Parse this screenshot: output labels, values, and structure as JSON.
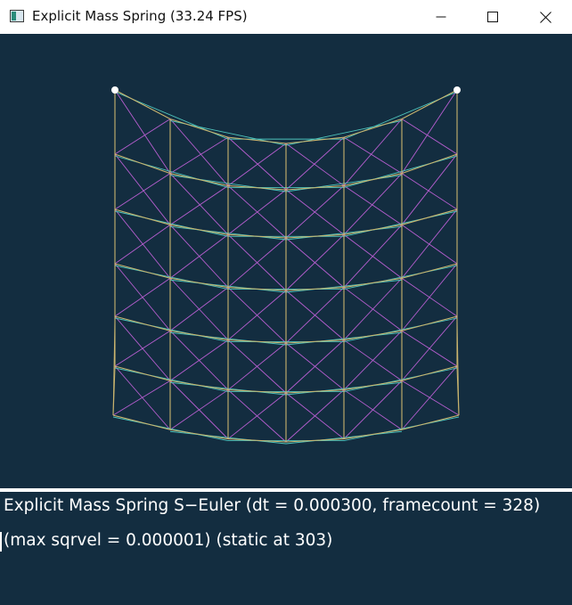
{
  "window": {
    "title": "Explicit Mass Spring (33.24 FPS)",
    "controls": {
      "minimize": "minimize-icon",
      "maximize": "maximize-icon",
      "close": "close-icon"
    }
  },
  "status": {
    "line1": "Explicit Mass Spring S−Euler (dt = 0.000300, framecount = 328)",
    "line2": "(max sqrvel = 0.000001) (static at 303)"
  },
  "simulation": {
    "grid_cols": 7,
    "grid_rows": 7,
    "pinned_nodes": [
      "top-left",
      "top-right"
    ]
  },
  "colors": {
    "background": "#132d40",
    "structural_spring": "#c9b46e",
    "shear_spring": "#b75ed0",
    "bend_spring": "#4ec4bc",
    "pinned_node": "#ffffff",
    "status_text": "#ffffff"
  }
}
